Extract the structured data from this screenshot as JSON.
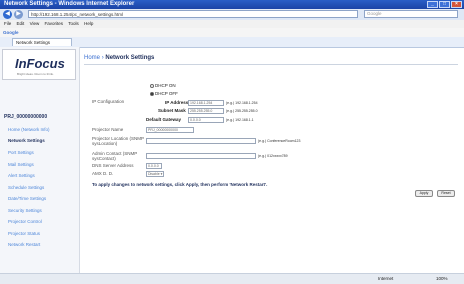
{
  "window": {
    "title": "Network Settings - Windows Internet Explorer"
  },
  "browser": {
    "url": "http://192.168.1.254/pc_network_settings.html",
    "search_placeholder": "Google",
    "menu": [
      "File",
      "Edit",
      "View",
      "Favorites",
      "Tools",
      "Help"
    ],
    "google_label": "Google",
    "tab_label": "Network Settings"
  },
  "sidebar": {
    "logo": "InFocus",
    "logo_tagline": "Bright ideas. Room to think.",
    "device_name": "PRJ_00000000000",
    "items": [
      {
        "label": "Home (Network Info)",
        "active": false
      },
      {
        "label": "Network Settings",
        "active": true
      },
      {
        "label": "Port Settings",
        "active": false
      },
      {
        "label": "Mail Settings",
        "active": false
      },
      {
        "label": "Alert Settings",
        "active": false
      },
      {
        "label": "Schedule Settings",
        "active": false
      },
      {
        "label": "Date/Time Settings",
        "active": false
      },
      {
        "label": "Security Settings",
        "active": false
      },
      {
        "label": "Projector Control",
        "active": false
      },
      {
        "label": "Projector Status",
        "active": false
      },
      {
        "label": "Network Restart",
        "active": false
      }
    ]
  },
  "main": {
    "breadcrumb_home": "Home",
    "breadcrumb_current": "Network Settings",
    "ip_config_label": "IP Configuration",
    "dhcp_on": "DHCP ON",
    "dhcp_off": "DHCP OFF",
    "ip_address_label": "IP Address",
    "ip_address_value": "192.168.1.254",
    "ip_hint": "(e.g.) 192.168.1.254",
    "subnet_label": "Subnet Mask",
    "subnet_value": "255.255.255.0",
    "subnet_hint": "(e.g.) 255.255.255.0",
    "gateway_label": "Default Gateway",
    "gateway_value": "0.0.0.0",
    "gateway_hint": "(e.g.) 192.168.1.1",
    "projector_name_label": "Projector Name",
    "projector_name_value": "PRJ_00000000000",
    "location_label": "Projector Location (SNMP sysLocation)",
    "location_hint": "(e.g.) ConferenceRoom123",
    "contact_label": "Admin Contact (SNMP sysContact)",
    "contact_hint": "(e.g.) 012xxxxx789",
    "dns_label": "DNS Server Address",
    "dns_value": "0.0.0.0",
    "amx_label": "AMX D. D.",
    "amx_value": "Disable",
    "note": "To apply changes to network settings, click Apply, then perform 'Network Restart'.",
    "apply_label": "Apply",
    "reset_label": "Reset"
  },
  "status": {
    "zone": "Internet",
    "zoom": "100%"
  }
}
